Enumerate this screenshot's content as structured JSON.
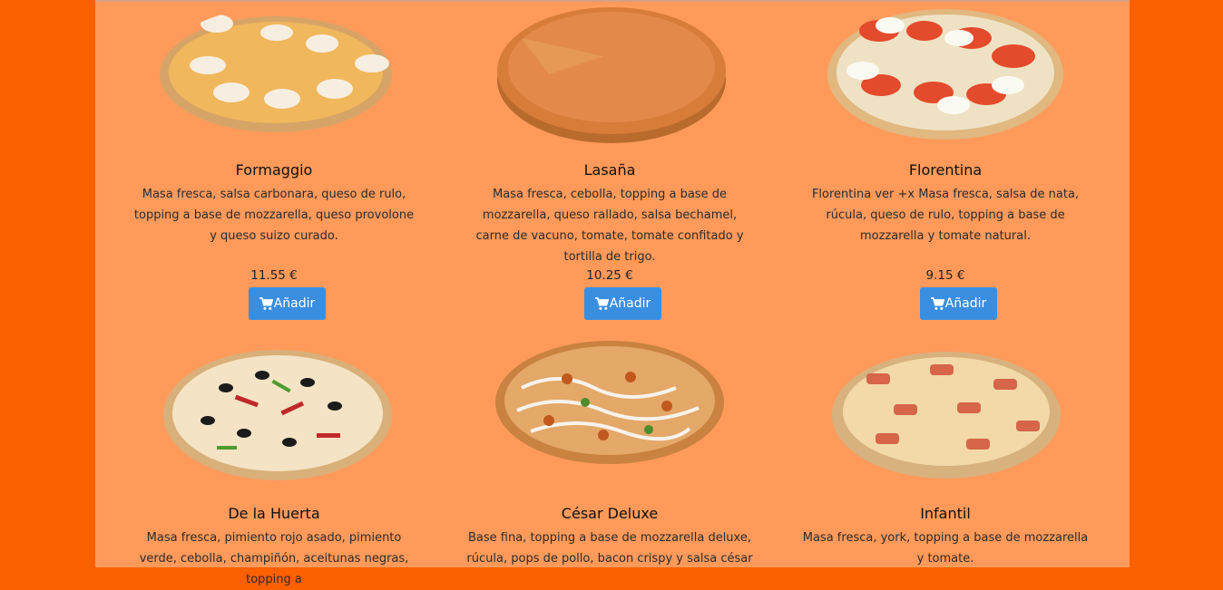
{
  "menu": {
    "button_label": "Añadir",
    "items": [
      {
        "name": "Formaggio",
        "description": "Masa fresca, salsa carbonara, queso de rulo, topping a base de mozzarella, queso provolone y queso suizo curado.",
        "price": "11.55 €"
      },
      {
        "name": "Lasaña",
        "description": "Masa fresca, cebolla, topping a base de mozzarella, queso rallado, salsa bechamel, carne de vacuno, tomate, tomate confitado y tortilla de trigo.",
        "price": "10.25 €"
      },
      {
        "name": "Florentina",
        "description": "Florentina ver +x Masa fresca, salsa de nata, rúcula, queso de rulo, topping a base de mozzarella y tomate natural.",
        "price": "9.15 €"
      },
      {
        "name": "De la Huerta",
        "description": "Masa fresca, pimiento rojo asado, pimiento verde, cebolla, champiñón, aceitunas negras, topping a"
      },
      {
        "name": "César Deluxe",
        "description": "Base fina, topping a base de mozzarella deluxe, rúcula, pops de pollo, bacon crispy y salsa césar"
      },
      {
        "name": "Infantil",
        "description": "Masa fresca, york, topping a base de mozzarella y tomate."
      }
    ]
  },
  "colors": {
    "page_bg": "#fc6000",
    "panel_bg": "#ff9a5b",
    "button_bg": "#3a8ee0"
  },
  "icons": {
    "button_icon": "cart-icon",
    "product_images": "pizza-image"
  }
}
